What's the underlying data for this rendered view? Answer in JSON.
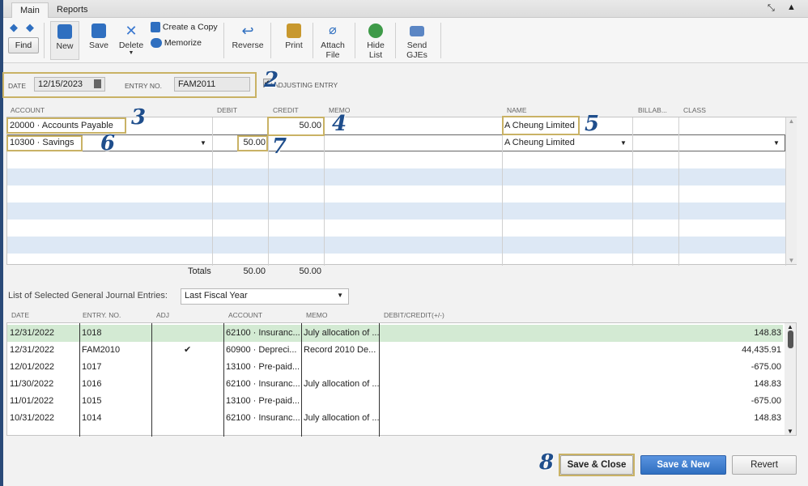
{
  "tabs": [
    {
      "label": "Main"
    },
    {
      "label": "Reports"
    }
  ],
  "toolbar": {
    "find": "Find",
    "new": "New",
    "save": "Save",
    "delete": "Delete",
    "create_copy": "Create a Copy",
    "memorize": "Memorize",
    "reverse": "Reverse",
    "print": "Print",
    "attach_1": "Attach",
    "attach_2": "File",
    "hide_1": "Hide",
    "hide_2": "List",
    "send_1": "Send",
    "send_2": "GJEs"
  },
  "header": {
    "date_label": "DATE",
    "date_value": "12/15/2023",
    "entry_label": "ENTRY NO.",
    "entry_value": "FAM2011",
    "adjusting_label": "ADJUSTING ENTRY",
    "adjusting_checked": true
  },
  "grid": {
    "columns": [
      "ACCOUNT",
      "DEBIT",
      "CREDIT",
      "MEMO",
      "NAME",
      "BILLAB...",
      "CLASS"
    ],
    "rows": [
      {
        "account": "20000 · Accounts Payable",
        "debit": "",
        "credit": "50.00",
        "memo": "",
        "name": "A Cheung Limited"
      },
      {
        "account": "10300 · Savings",
        "debit": "50.00",
        "credit": "",
        "memo": "",
        "name": "A Cheung Limited"
      }
    ],
    "totals_label": "Totals",
    "total_debit": "50.00",
    "total_credit": "50.00"
  },
  "list": {
    "label": "List of Selected General Journal Entries:",
    "filter": "Last Fiscal Year",
    "columns": [
      "DATE",
      "ENTRY. NO.",
      "ADJ",
      "ACCOUNT",
      "MEMO",
      "DEBIT/CREDIT(+/-)"
    ],
    "rows": [
      {
        "date": "12/31/2022",
        "entry": "1018",
        "adj": "",
        "account": "62100 · Insuranc...",
        "memo": "July allocation of ...",
        "amount": "148.83"
      },
      {
        "date": "12/31/2022",
        "entry": "FAM2010",
        "adj": "✔",
        "account": "60900 · Depreci...",
        "memo": "Record 2010 De...",
        "amount": "44,435.91"
      },
      {
        "date": "12/01/2022",
        "entry": "1017",
        "adj": "",
        "account": "13100 · Pre-paid...",
        "memo": "",
        "amount": "-675.00"
      },
      {
        "date": "11/30/2022",
        "entry": "1016",
        "adj": "",
        "account": "62100 · Insuranc...",
        "memo": "July allocation of ...",
        "amount": "148.83"
      },
      {
        "date": "11/01/2022",
        "entry": "1015",
        "adj": "",
        "account": "13100 · Pre-paid...",
        "memo": "",
        "amount": "-675.00"
      },
      {
        "date": "10/31/2022",
        "entry": "1014",
        "adj": "",
        "account": "62100 · Insuranc...",
        "memo": "July allocation of ...",
        "amount": "148.83"
      }
    ]
  },
  "buttons": {
    "save_close": "Save & Close",
    "save_new": "Save & New",
    "revert": "Revert"
  },
  "annotations": [
    "2",
    "3",
    "4",
    "5",
    "6",
    "7",
    "8"
  ],
  "colors": {
    "accent": "#3a78d0",
    "selected_row": "#d3ead3",
    "stripe": "#dde8f5",
    "annotation_box": "#c9b265",
    "annotation_number": "#1f4e8c"
  }
}
